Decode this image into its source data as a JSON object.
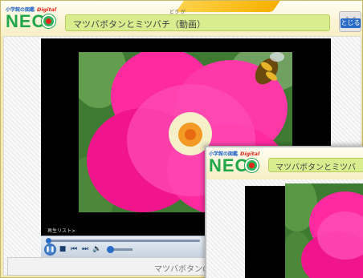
{
  "app": {
    "brand_top": "小学館の図鑑",
    "brand_digital": "Digital",
    "brand_neo": "NEO"
  },
  "header": {
    "title": "マツバボタンとミツバチ（動画）",
    "ruby": "どう が",
    "close_label": "とじる"
  },
  "player": {
    "caption_label": "再生リスト>",
    "play_icon": "pause-icon",
    "buttons": [
      "stop-icon",
      "previous-icon",
      "next-icon",
      "volume-icon"
    ]
  },
  "footer": {
    "caption": "マツバボタンの"
  },
  "second_window": {
    "brand_top": "小学館の図鑑",
    "brand_digital": "Digital",
    "brand_neo": "NEO",
    "title": "マツバボタンとミツバ"
  },
  "colors": {
    "header_bg": "#f7efc4",
    "title_bar": "#d9ec8e",
    "neo_green": "#1fa74a",
    "accent_blue": "#2a6bc8",
    "flower_pink": "#ff2aa0"
  }
}
